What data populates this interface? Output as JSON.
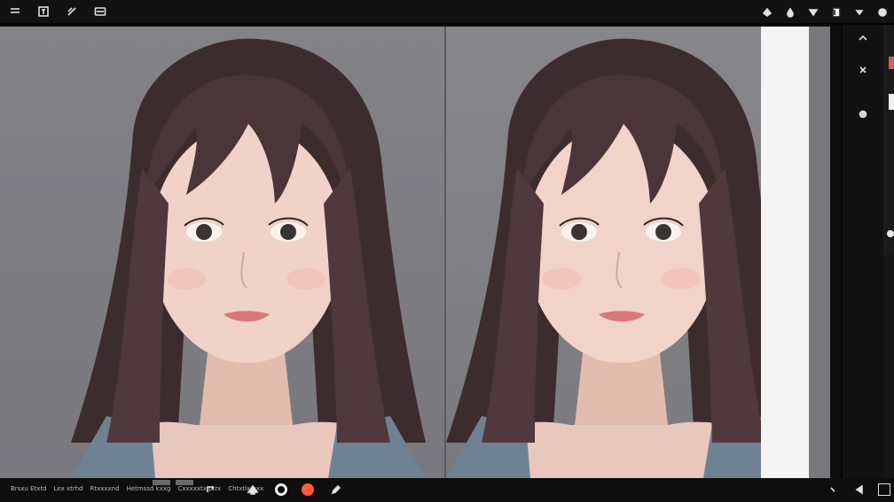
{
  "toolbar": {
    "left_icons": [
      "menu-icon",
      "frame-icon",
      "brush-icon",
      "panel-icon"
    ],
    "right_icons": [
      "fill-icon",
      "drop-icon",
      "filter-icon",
      "crop-icon",
      "dropdown-icon",
      "settings-icon"
    ]
  },
  "canvas": {
    "background_color": "#7b7b80",
    "strip_color": "#f4f4f4"
  },
  "side_panel": {
    "icons": [
      "chevron-up-icon",
      "close-icon",
      "target-icon"
    ],
    "swatch_accent": "#e05a5a",
    "swatch_light": "#f0f0f0"
  },
  "bottom_bar": {
    "status_items": [
      "Brsxu Etxtd",
      "Lex xtrhd",
      "Rtxxxxnd",
      "Hetmssd kxxg",
      "Cxxxxxtx ptrx",
      "Chtxtlx bxx"
    ],
    "tools": [
      "undo-icon",
      "brush-tool-icon",
      "stop-icon",
      "color-dot-icon",
      "pen-icon"
    ],
    "accent_color": "#ff5a3c"
  }
}
